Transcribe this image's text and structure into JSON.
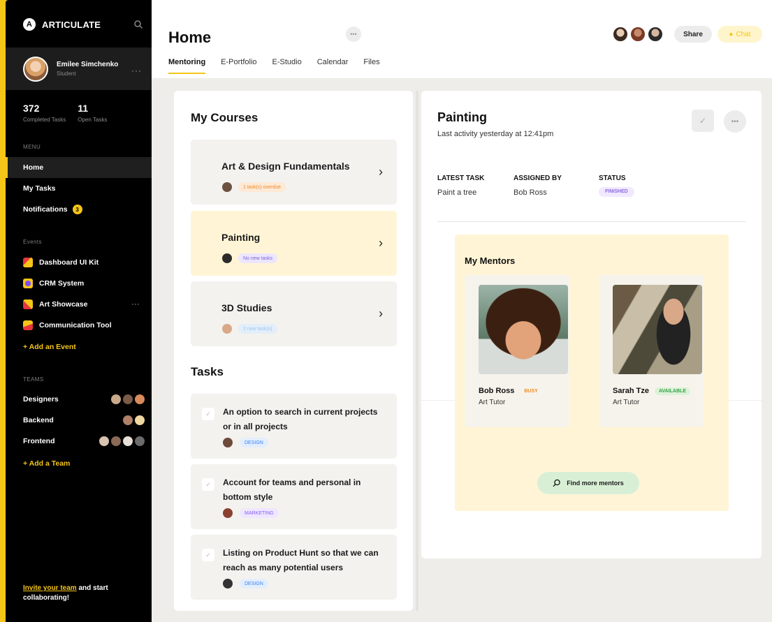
{
  "app": {
    "brand": "ARTICULATE",
    "logo_letter": "A"
  },
  "user": {
    "name": "Emilee Simchenko",
    "role": "Student"
  },
  "stats": [
    {
      "value": "372",
      "label": "Completed Tasks"
    },
    {
      "value": "11",
      "label": "Open Tasks"
    }
  ],
  "menu": {
    "label": "MENU",
    "items": [
      {
        "label": "Home",
        "active": true
      },
      {
        "label": "My Tasks"
      },
      {
        "label": "Notifications",
        "badge": "3"
      }
    ]
  },
  "events": {
    "label": "Events",
    "items": [
      {
        "label": "Dashboard UI Kit",
        "color": "#f5c518",
        "accent": "#e8363b"
      },
      {
        "label": "CRM System",
        "color": "#f5c518",
        "accent": "#7c4dff"
      },
      {
        "label": "Art Showcase",
        "color": "#f5c518",
        "accent": "#e8363b"
      },
      {
        "label": "Communication Tool",
        "color": "#f5c518",
        "accent": "#e8363b"
      }
    ],
    "add_label": "+ Add an Event"
  },
  "teams": {
    "label": "TEAMS",
    "items": [
      {
        "label": "Designers"
      },
      {
        "label": "Backend"
      },
      {
        "label": "Frontend"
      }
    ],
    "add_label": "+ Add a Team"
  },
  "invite": {
    "highlight": "Invite your team",
    "rest": " and start collaborating!"
  },
  "header": {
    "title": "Home",
    "share_label": "Share",
    "chat_label": "Chat",
    "tabs": [
      "Mentoring",
      "E-Portfolio",
      "E-Studio",
      "Calendar",
      "Files"
    ]
  },
  "courses": {
    "title": "My Courses",
    "items": [
      {
        "title": "Art & Design Fundamentals",
        "tag": "1 task(s) overdue",
        "tag_color": "#f08a24",
        "tag_bg": "#fde9d6"
      },
      {
        "title": "Painting",
        "tag": "No new tasks",
        "tag_color": "#7c63d6",
        "tag_bg": "#ece6ff"
      },
      {
        "title": "3D Studies",
        "tag": "2 new task(s)",
        "tag_color": "#9cc6ef",
        "tag_bg": "#e2eefa"
      }
    ]
  },
  "tasks": {
    "title": "Tasks",
    "items": [
      {
        "title": "An option to search in current projects or in all projects",
        "tag": "DESIGN",
        "tag_color": "#3b82f6",
        "tag_bg": "#e3eefc"
      },
      {
        "title": "Account for teams and personal in bottom style",
        "tag": "MARKETING",
        "tag_color": "#8b5cf6",
        "tag_bg": "#efe7ff"
      },
      {
        "title": "Listing on Product Hunt so that we can reach as many potential users",
        "tag": "DESIGN",
        "tag_color": "#3b82f6",
        "tag_bg": "#e3eefc"
      }
    ]
  },
  "detail": {
    "title": "Painting",
    "subtitle": "Last activity yesterday at 12:41pm",
    "latest_task_label": "LATEST TASK",
    "latest_task": "Paint a tree",
    "assigned_by_label": "ASSIGNED BY",
    "assigned_by": "Bob Ross",
    "status_label": "STATUS",
    "status": "FINISHED"
  },
  "mentors": {
    "title": "My Mentors",
    "items": [
      {
        "name": "Bob Ross",
        "status": "BUSY",
        "status_color": "#f08a24",
        "role": "Art Tutor"
      },
      {
        "name": "Sarah Tze",
        "status": "AVAILABLE",
        "status_color": "#3aa14a",
        "role": "Art Tutor"
      }
    ],
    "find_more_label": "Find more mentors"
  },
  "colors": {
    "accent": "#f5c518",
    "sidebar": "#000000",
    "background": "#efede9"
  }
}
